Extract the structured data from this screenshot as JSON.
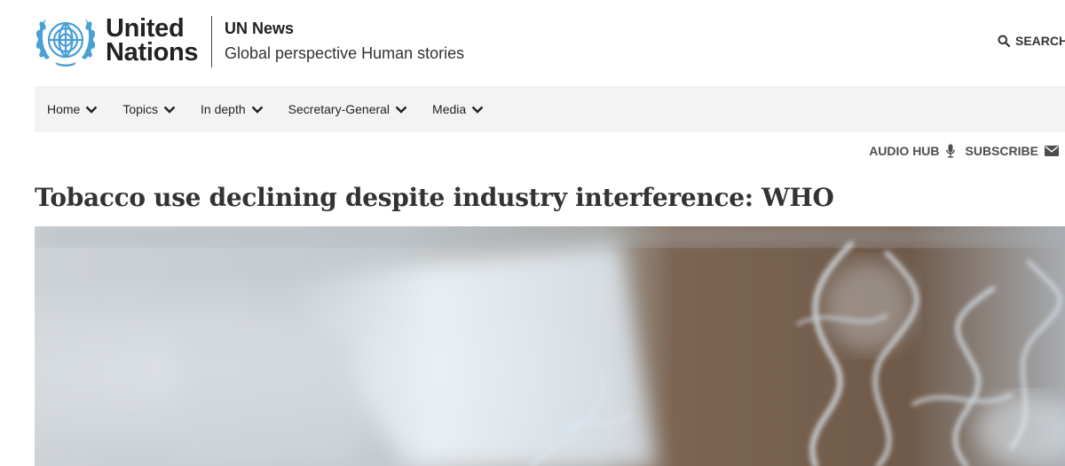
{
  "brand": {
    "logo_line1": "United",
    "logo_line2": "Nations",
    "site_name": "UN News",
    "tagline": "Global perspective Human stories"
  },
  "header": {
    "search_label": "SEARCH"
  },
  "nav": {
    "items": [
      {
        "label": "Home"
      },
      {
        "label": "Topics"
      },
      {
        "label": "In depth"
      },
      {
        "label": "Secretary-General"
      },
      {
        "label": "Media"
      }
    ]
  },
  "utility": {
    "audio_hub": "AUDIO HUB",
    "subscribe": "SUBSCRIBE"
  },
  "article": {
    "title": "Tobacco use declining despite industry interference: WHO"
  },
  "colors": {
    "un_blue": "#4a9fd5",
    "nav_bg": "#f3f3f3",
    "text": "#333333"
  }
}
